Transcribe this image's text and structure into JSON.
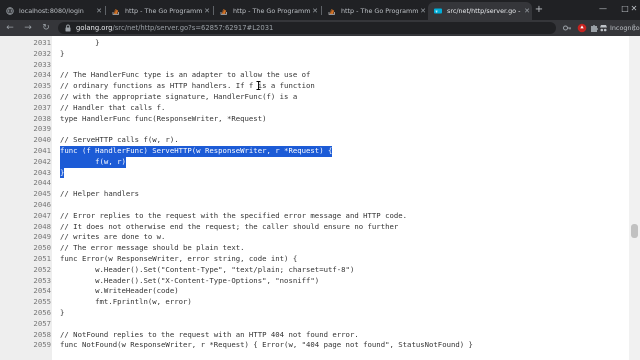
{
  "tabs": [
    {
      "title": "localhost:8080/login",
      "favicon": "globe-icon"
    },
    {
      "title": "http - The Go Programming",
      "favicon": "stackoverflow-icon"
    },
    {
      "title": "http - The Go Programming",
      "favicon": "stackoverflow-icon"
    },
    {
      "title": "http - The Go Programming",
      "favicon": "stackoverflow-icon"
    },
    {
      "title": "src/net/http/server.go - Th",
      "favicon": "go-icon",
      "active": true
    }
  ],
  "toolbar": {
    "url_host": "golang.org",
    "url_path": "/src/net/http/server.go?s=62857:62917#L2031",
    "profile_label": "Incognito"
  },
  "code": {
    "highlight_lines": [
      2041,
      2042,
      2043
    ],
    "lines": [
      {
        "num": "2031",
        "text": "        }"
      },
      {
        "num": "2032",
        "text": "}"
      },
      {
        "num": "2033",
        "text": ""
      },
      {
        "num": "2034",
        "text": "// The HandlerFunc type is an adapter to allow the use of"
      },
      {
        "num": "2035",
        "text": "// ordinary functions as HTTP handlers. If f is a function"
      },
      {
        "num": "2036",
        "text": "// with the appropriate signature, HandlerFunc(f) is a"
      },
      {
        "num": "2037",
        "text": "// Handler that calls f."
      },
      {
        "num": "2038",
        "text": "type HandlerFunc func(ResponseWriter, *Request)"
      },
      {
        "num": "2039",
        "text": ""
      },
      {
        "num": "2040",
        "text": "// ServeHTTP calls f(w, r)."
      },
      {
        "num": "2041",
        "text": "func (f HandlerFunc) ServeHTTP(w ResponseWriter, r *Request) {"
      },
      {
        "num": "2042",
        "text": "        f(w, r)"
      },
      {
        "num": "2043",
        "text": "}"
      },
      {
        "num": "2044",
        "text": ""
      },
      {
        "num": "2045",
        "text": "// Helper handlers"
      },
      {
        "num": "2046",
        "text": ""
      },
      {
        "num": "2047",
        "text": "// Error replies to the request with the specified error message and HTTP code."
      },
      {
        "num": "2048",
        "text": "// It does not otherwise end the request; the caller should ensure no further"
      },
      {
        "num": "2049",
        "text": "// writes are done to w."
      },
      {
        "num": "2050",
        "text": "// The error message should be plain text."
      },
      {
        "num": "2051",
        "text": "func Error(w ResponseWriter, error string, code int) {"
      },
      {
        "num": "2052",
        "text": "        w.Header().Set(\"Content-Type\", \"text/plain; charset=utf-8\")"
      },
      {
        "num": "2053",
        "text": "        w.Header().Set(\"X-Content-Type-Options\", \"nosniff\")"
      },
      {
        "num": "2054",
        "text": "        w.WriteHeader(code)"
      },
      {
        "num": "2055",
        "text": "        fmt.Fprintln(w, error)"
      },
      {
        "num": "2056",
        "text": "}"
      },
      {
        "num": "2057",
        "text": ""
      },
      {
        "num": "2058",
        "text": "// NotFound replies to the request with an HTTP 404 not found error."
      },
      {
        "num": "2059",
        "text": "func NotFound(w ResponseWriter, r *Request) { Error(w, \"404 page not found\", StatusNotFound) }"
      }
    ]
  }
}
